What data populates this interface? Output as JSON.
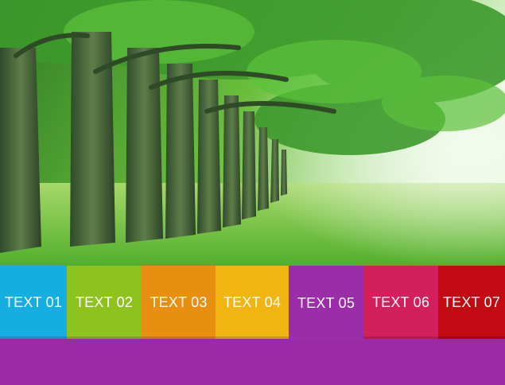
{
  "tabs": [
    {
      "label": "TEXT 01",
      "color": "#16aee0",
      "active": false
    },
    {
      "label": "TEXT 02",
      "color": "#8dc21f",
      "active": false
    },
    {
      "label": "TEXT 03",
      "color": "#e88f12",
      "active": false
    },
    {
      "label": "TEXT 04",
      "color": "#f0b511",
      "active": false
    },
    {
      "label": "TEXT 05",
      "color": "#9b2ea8",
      "active": true
    },
    {
      "label": "TEXT 06",
      "color": "#d2205c",
      "active": false
    },
    {
      "label": "TEXT 07",
      "color": "#c10a12",
      "active": false
    }
  ],
  "panel": {
    "color": "#9a2aa6"
  },
  "photo": {
    "subject": "forest-tree-lane"
  }
}
